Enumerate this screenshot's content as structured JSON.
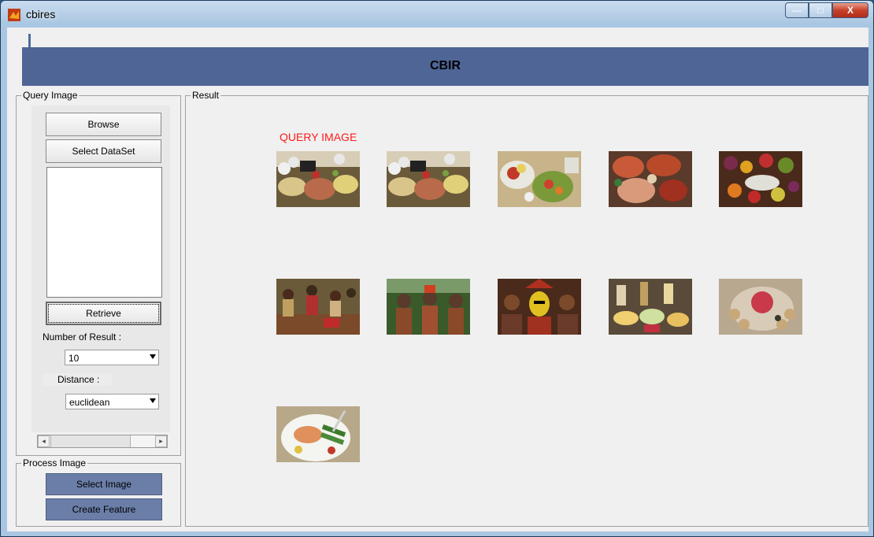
{
  "window": {
    "title": "cbires",
    "minimize": "—",
    "maximize": "□",
    "close": "X"
  },
  "banner": {
    "title": "CBIR"
  },
  "query_panel": {
    "label": "Query Image",
    "browse_label": "Browse",
    "select_dataset_label": "Select DataSet",
    "retrieve_label": "Retrieve",
    "num_results_label": "Number of Result :",
    "num_results_value": "10",
    "distance_label": "Distance :",
    "distance_value": "euclidean"
  },
  "process_panel": {
    "label": "Process Image",
    "select_image_label": "Select Image",
    "create_feature_label": "Create Feature"
  },
  "result_panel": {
    "label": "Result",
    "query_image_label": "QUERY IMAGE"
  },
  "colors": {
    "banner": "#4e6595",
    "process_button": "#6a7ea8",
    "query_label": "#ff1a1a"
  },
  "results": [
    {
      "icon": "food-platter-image"
    },
    {
      "icon": "food-platter-image"
    },
    {
      "icon": "salad-vegetables-image"
    },
    {
      "icon": "meat-fish-platter-image"
    },
    {
      "icon": "fruit-platter-image"
    },
    {
      "icon": "crowd-people-image"
    },
    {
      "icon": "painted-warriors-image"
    },
    {
      "icon": "tribal-face-paint-image"
    },
    {
      "icon": "cheese-wine-image"
    },
    {
      "icon": "decorated-plate-image"
    },
    {
      "icon": "fish-dinner-plate-image"
    }
  ]
}
